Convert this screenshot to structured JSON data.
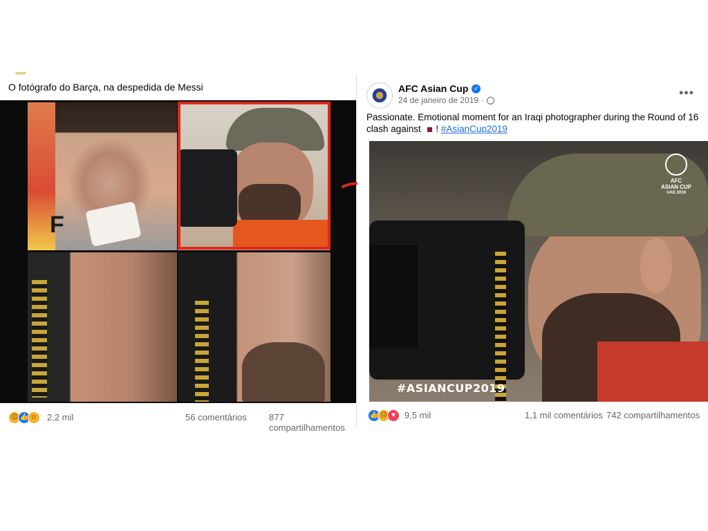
{
  "left_post": {
    "caption": "O fotógrafo do Barça, na despedida de Messi",
    "panel_letter": "F",
    "reactions": [
      "sad",
      "like",
      "haha"
    ],
    "reaction_count": "2,2 mil",
    "comments": "56 comentários",
    "shares": "877 compartilhamentos"
  },
  "right_post": {
    "page_name": "AFC Asian Cup",
    "date": "24 de janeiro de 2019",
    "text_before_flag": "Passionate. Emotional moment for an Iraqi photographer during the Round of 16 clash against ",
    "text_after_flag": " ! ",
    "hashtag": "#AsianCup2019",
    "image_watermark_top": "AFC",
    "image_watermark_mid": "ASIAN CUP",
    "image_watermark_bottom": "UAE 2019",
    "image_hashtag": "#ASIANCUP2019",
    "reactions": [
      "like",
      "sad",
      "love"
    ],
    "reaction_count": "9,5 mil",
    "comments": "1,1 mil comentários",
    "shares": "742 compartilhamentos"
  },
  "colors": {
    "highlight_border": "#e0271c",
    "link_blue": "#216fdb",
    "verified_blue": "#1877f2",
    "muted_text": "#65676b"
  }
}
